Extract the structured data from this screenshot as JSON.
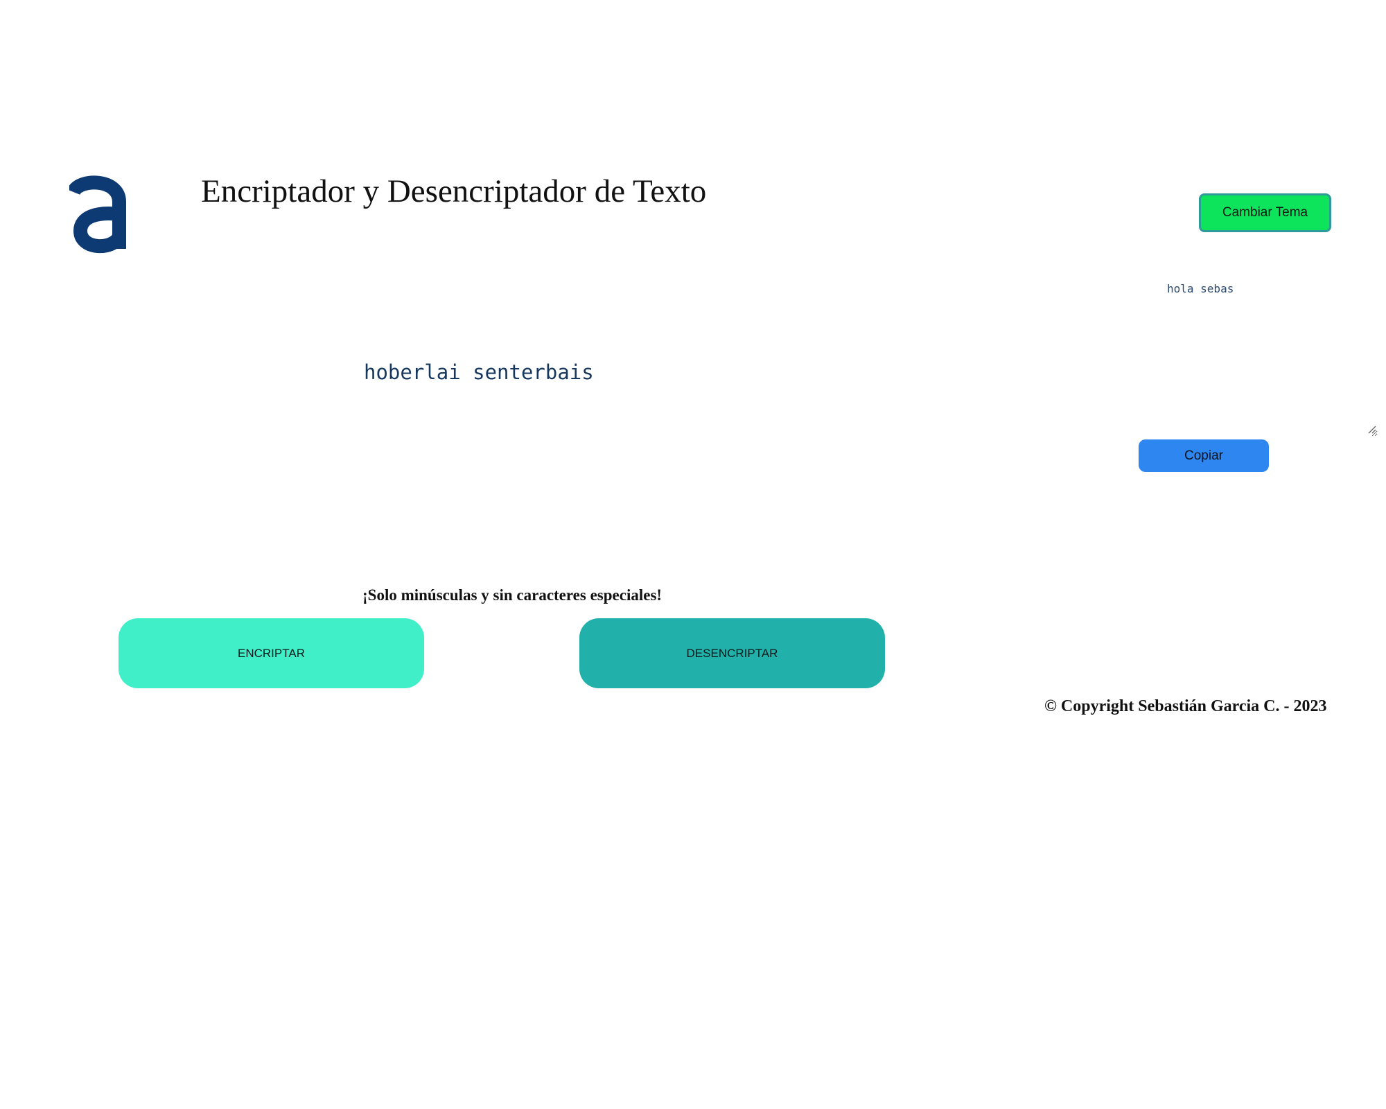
{
  "header": {
    "logo_icon": "alura-a-logo-icon",
    "logo_color": "#0d3a72",
    "title": "Encriptador y Desencriptador de Texto",
    "theme_button_label": "Cambiar Tema"
  },
  "input": {
    "value": "hoberlai senterbais"
  },
  "output": {
    "value": "hola sebas",
    "copy_button_label": "Copiar"
  },
  "controls": {
    "warning_text": "¡Solo minúsculas y sin caracteres especiales!",
    "encrypt_label": "ENCRIPTAR",
    "decrypt_label": "DESENCRIPTAR"
  },
  "footer": {
    "copyright": "© Copyright Sebastián Garcia C. - 2023"
  },
  "colors": {
    "theme_button": "#0ee35c",
    "copy_button": "#2e86f0",
    "encrypt_button": "#40efc8",
    "decrypt_button": "#22b0aa"
  }
}
